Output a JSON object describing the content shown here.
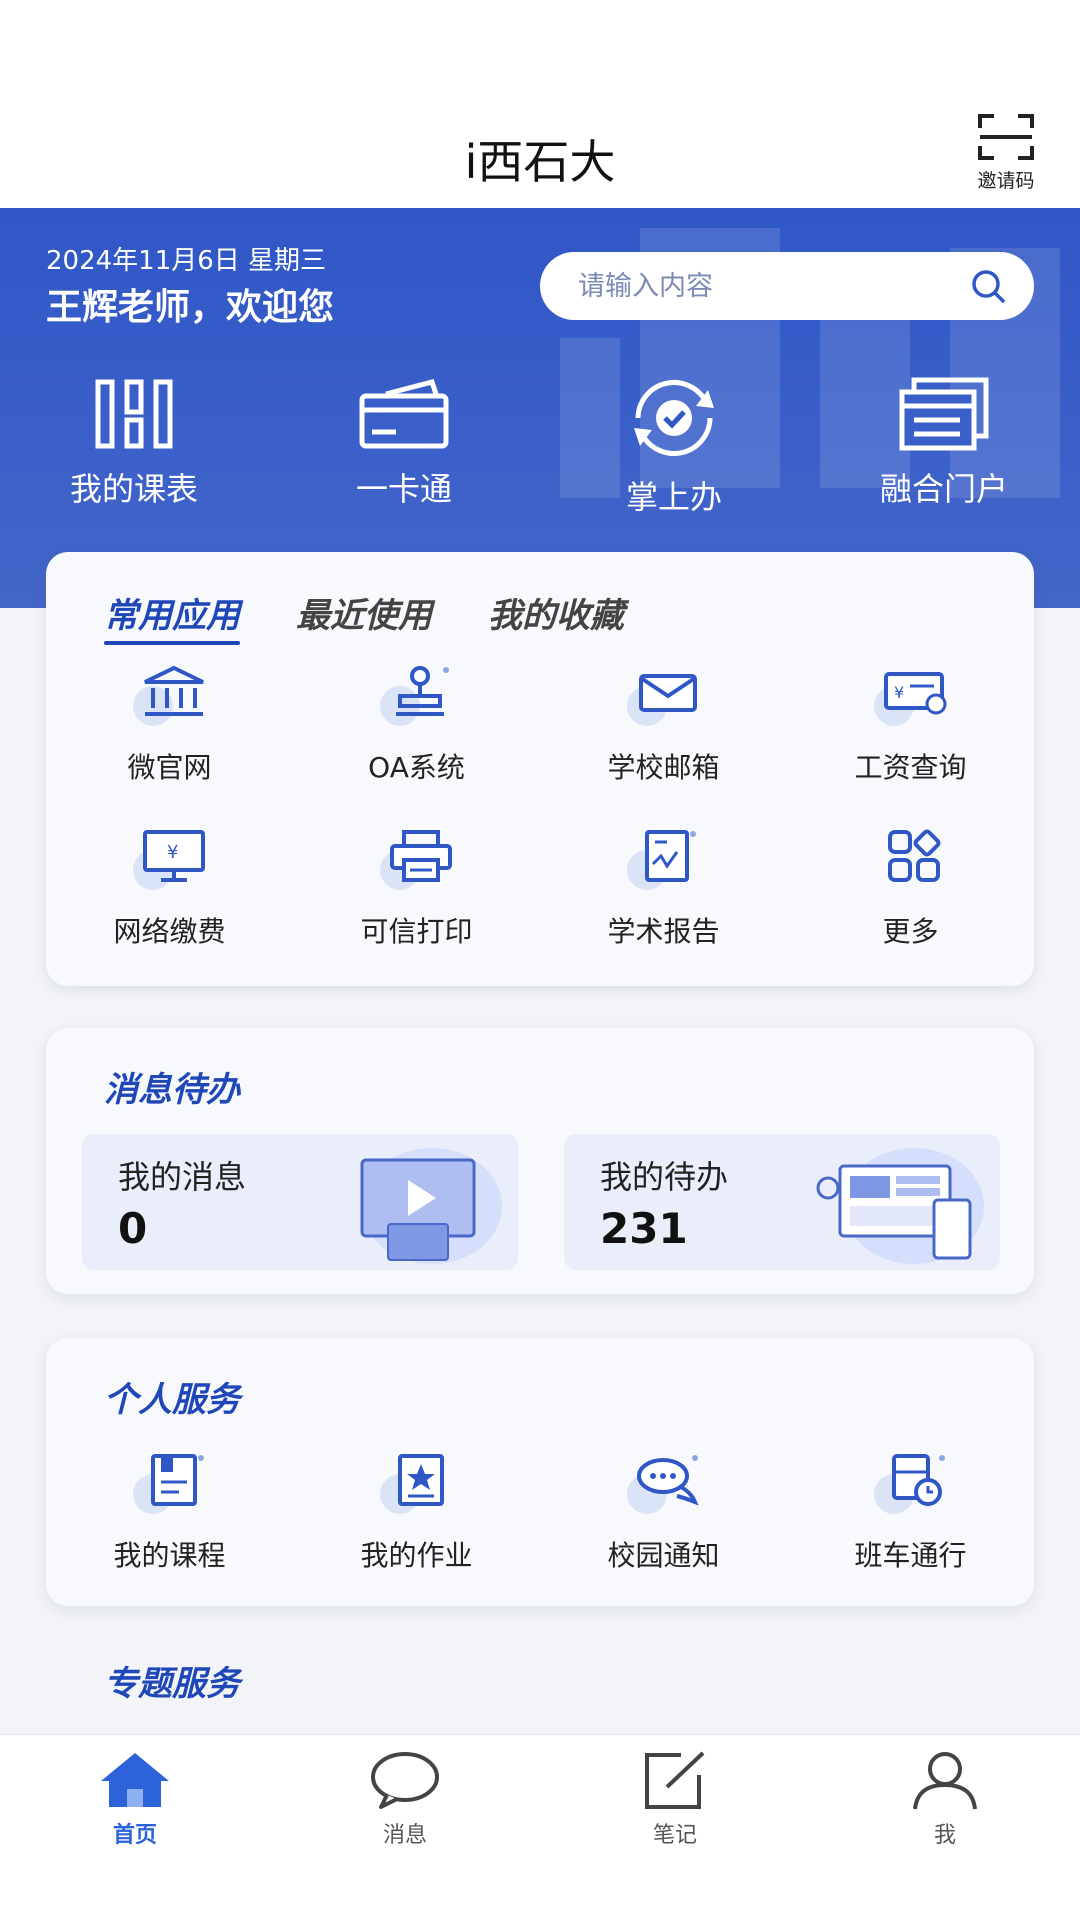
{
  "header": {
    "title": "i西石大",
    "invite_label": "邀请码"
  },
  "hero": {
    "date": "2024年11月6日  星期三",
    "welcome": "王辉老师，欢迎您",
    "search_placeholder": "请输入内容",
    "quick_actions": [
      {
        "label": "我的课表",
        "icon": "schedule-icon"
      },
      {
        "label": "一卡通",
        "icon": "card-icon"
      },
      {
        "label": "掌上办",
        "icon": "sync-check-icon"
      },
      {
        "label": "融合门户",
        "icon": "portal-icon"
      }
    ]
  },
  "apps_card": {
    "tabs": [
      "常用应用",
      "最近使用",
      "我的收藏"
    ],
    "active_tab": "常用应用",
    "row1": [
      {
        "label": "微官网",
        "icon": "bank-icon"
      },
      {
        "label": "OA系统",
        "icon": "stamp-icon"
      },
      {
        "label": "学校邮箱",
        "icon": "mail-icon"
      },
      {
        "label": "工资查询",
        "icon": "salary-icon"
      }
    ],
    "row2": [
      {
        "label": "网络缴费",
        "icon": "monitor-yen-icon"
      },
      {
        "label": "可信打印",
        "icon": "printer-icon"
      },
      {
        "label": "学术报告",
        "icon": "report-icon"
      },
      {
        "label": "更多",
        "icon": "more-grid-icon"
      }
    ]
  },
  "messages_card": {
    "title": "消息待办",
    "my_messages": {
      "label": "我的消息",
      "count": "0"
    },
    "my_todos": {
      "label": "我的待办",
      "count": "231"
    }
  },
  "personal_card": {
    "title": "个人服务",
    "items": [
      {
        "label": "我的课程",
        "icon": "course-book-icon"
      },
      {
        "label": "我的作业",
        "icon": "homework-star-icon"
      },
      {
        "label": "校园通知",
        "icon": "chat-bubbles-icon"
      },
      {
        "label": "班车通行",
        "icon": "bus-clock-icon"
      }
    ]
  },
  "special_title": "专题服务",
  "bottom_nav": [
    {
      "label": "首页",
      "icon": "home-icon",
      "active": true
    },
    {
      "label": "消息",
      "icon": "chat-icon",
      "active": false
    },
    {
      "label": "笔记",
      "icon": "note-edit-icon",
      "active": false
    },
    {
      "label": "我",
      "icon": "user-icon",
      "active": false
    }
  ],
  "colors": {
    "primary": "#2f57c6",
    "accent": "#1f47b8",
    "nav_active": "#2d63d8"
  }
}
